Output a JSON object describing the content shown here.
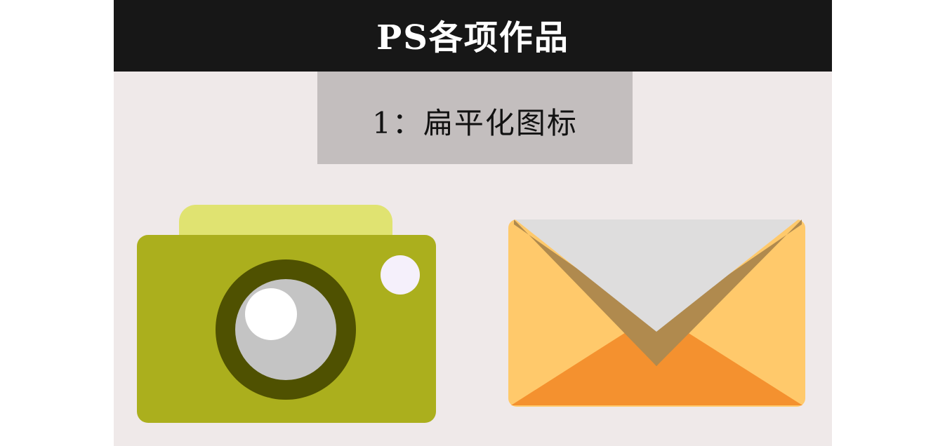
{
  "header": {
    "title": "PS各项作品"
  },
  "section": {
    "label": "1：扁平化图标"
  },
  "icons": [
    {
      "name": "camera-icon",
      "colors": {
        "top": "#e0e371",
        "body": "#abaf1d",
        "ring": "#4f5101",
        "lens": "#c4c4c4",
        "highlight": "#ffffff",
        "flash": "#f5f0fb"
      }
    },
    {
      "name": "envelope-icon",
      "colors": {
        "side": "#ffc96b",
        "flap": "#dedddd",
        "bottom": "#f4912f",
        "shadow": "#b08a4e",
        "inner_shadow": "#b3691a"
      }
    }
  ]
}
